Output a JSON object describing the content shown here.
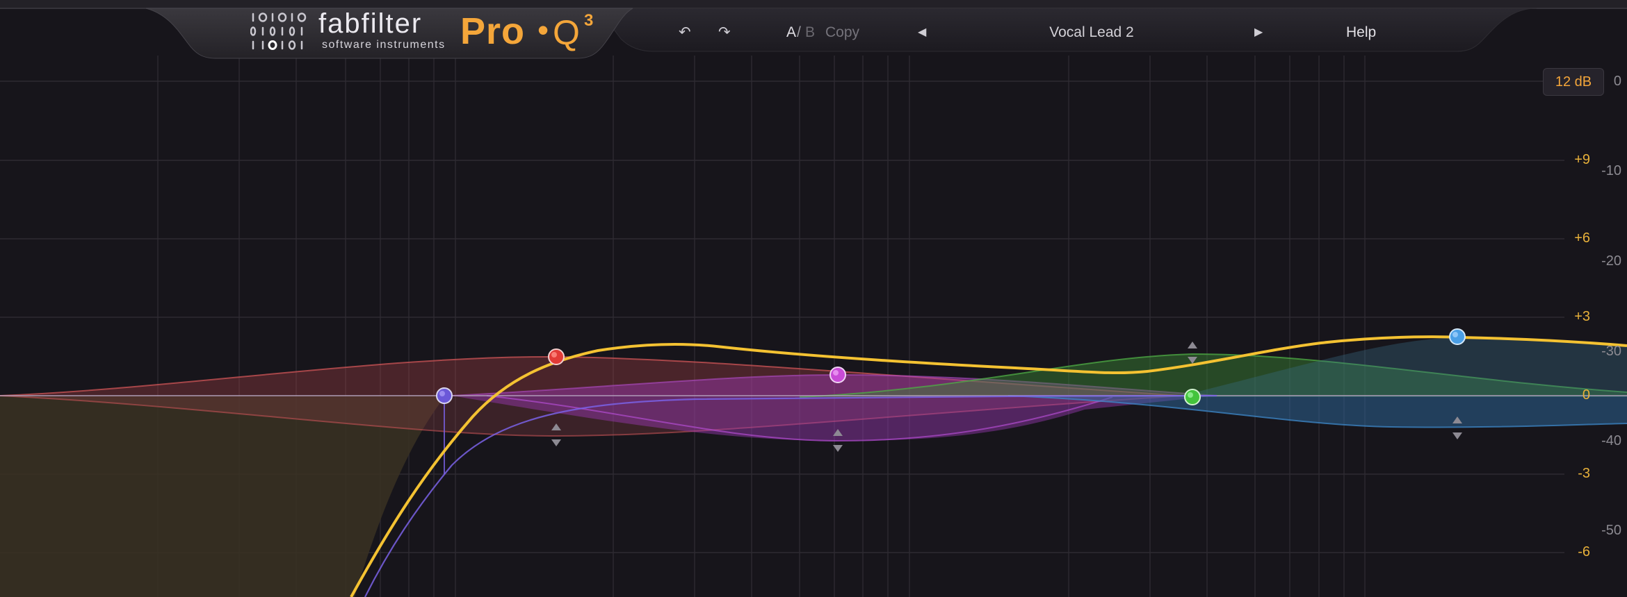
{
  "header": {
    "brand_name": "fabfilter",
    "brand_tagline": "software instruments",
    "product_name": "Pro",
    "product_separator": "•",
    "product_model": "Q",
    "product_version": "3",
    "undo_icon": "↶",
    "redo_icon": "↷",
    "ab_a": "A",
    "ab_slash": "/",
    "ab_b": "B",
    "copy_label": "Copy",
    "prev_icon": "◀",
    "next_icon": "▶",
    "preset_name": "Vocal Lead 2",
    "help_label": "Help"
  },
  "display": {
    "range_badge": "12 dB",
    "gain_scale": [
      "+9",
      "+6",
      "+3",
      "0",
      "-3",
      "-6"
    ],
    "spectrum_scale": [
      "0",
      "-10",
      "-20",
      "-30",
      "-40",
      "-50"
    ]
  },
  "colors": {
    "background": "#17151b",
    "accent": "#f4a63a",
    "curve": "#f4c232",
    "band_red": "#f0443f",
    "band_violet": "#7460e8",
    "band_magenta": "#c953d8",
    "band_green": "#53cc4a",
    "band_blue": "#4ea6ea"
  },
  "bands": [
    {
      "name": "band-1-low-cut",
      "color": "violet",
      "type": "low cut"
    },
    {
      "name": "band-2-bell",
      "color": "red",
      "type": "bell"
    },
    {
      "name": "band-3-bell",
      "color": "magenta",
      "type": "bell"
    },
    {
      "name": "band-4-bell",
      "color": "green",
      "type": "bell"
    },
    {
      "name": "band-5-high-shelf",
      "color": "blue",
      "type": "high shelf"
    }
  ]
}
